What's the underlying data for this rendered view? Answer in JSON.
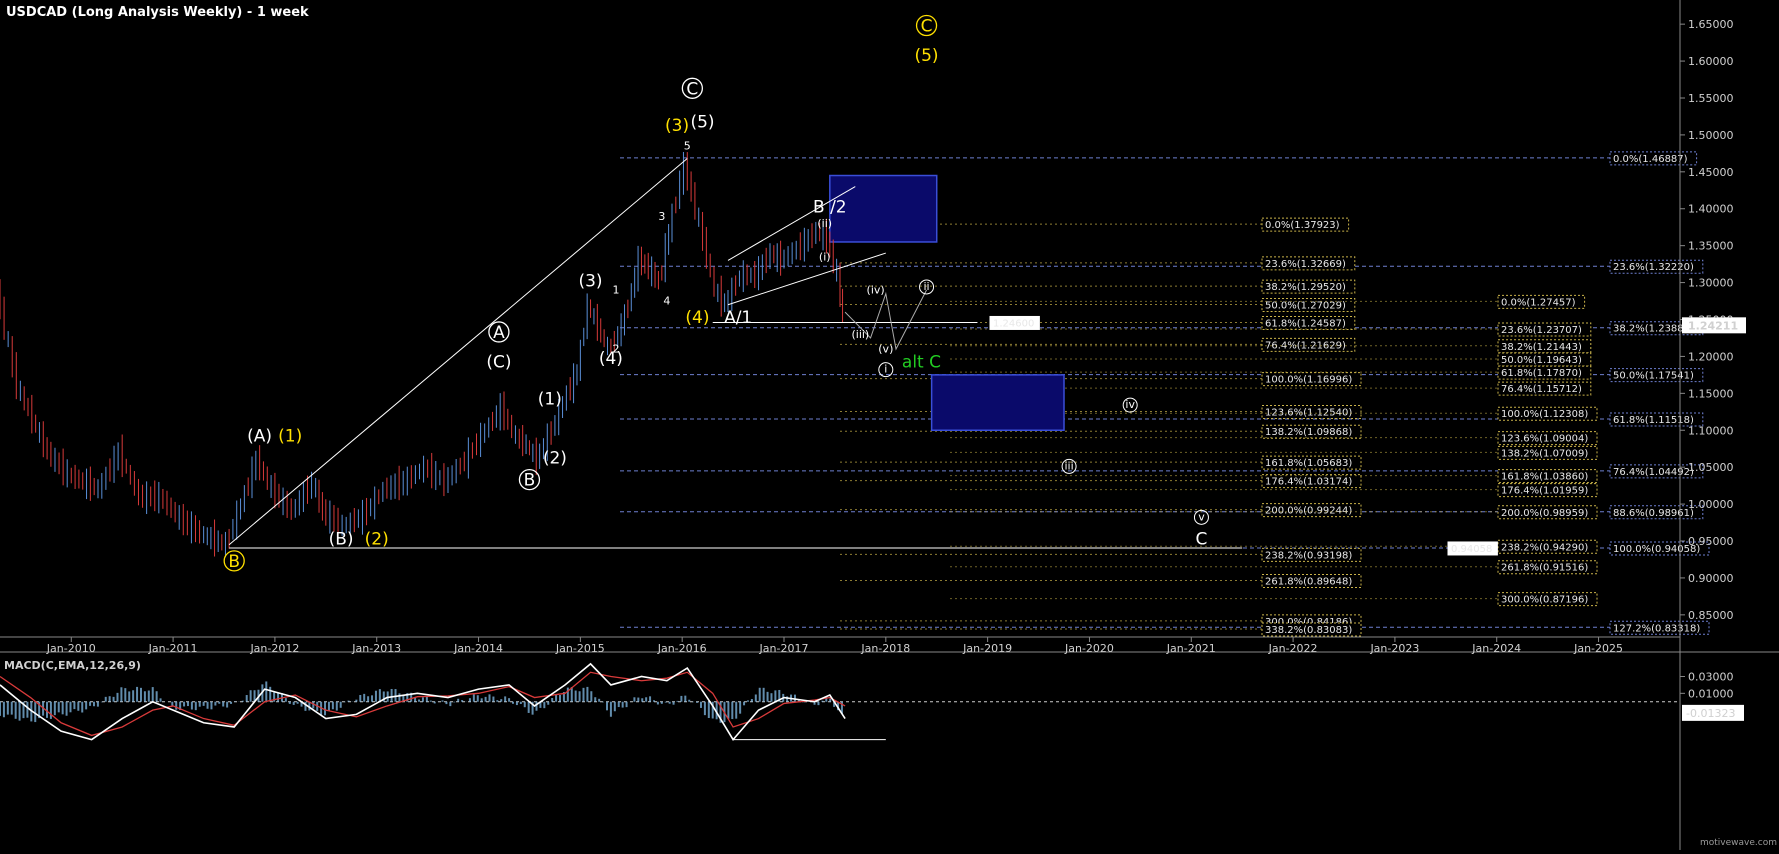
{
  "header": {
    "title": "USDCAD (Long  Analysis Weekly) - 1 week"
  },
  "footer": {
    "watermark": "motivewave.com"
  },
  "price_label": {
    "value": "1.24211",
    "price": 1.24211
  },
  "colors": {
    "background": "#000000",
    "bull_candle": "#5a8fd8",
    "bear_candle": "#d83a3a",
    "fib_grid": "#6e7fd0",
    "fib_box": "#c9b24a",
    "box_fill": "#0a0a6a",
    "box_stroke": "#3a4ed8",
    "wave_white": "#ffffff",
    "wave_yellow": "#ffe000",
    "wave_green": "#22cc22",
    "macd_line": "#ffffff",
    "signal_line": "#d83a3a",
    "hist": "#7ab0d8"
  },
  "chart_data": [
    {
      "type": "candlestick",
      "title": "USDCAD (Long  Analysis Weekly) - 1 week",
      "ylim": [
        0.82,
        1.68
      ],
      "xlim": [
        2009.3,
        2025.8
      ],
      "x_ticks": [
        "Jan-2010",
        "Jan-2011",
        "Jan-2012",
        "Jan-2013",
        "Jan-2014",
        "Jan-2015",
        "Jan-2016",
        "Jan-2017",
        "Jan-2018",
        "Jan-2019",
        "Jan-2020",
        "Jan-2021",
        "Jan-2022",
        "Jan-2023",
        "Jan-2024",
        "Jan-2025"
      ],
      "x_tick_positions": [
        2010,
        2011,
        2012,
        2013,
        2014,
        2015,
        2016,
        2017,
        2018,
        2019,
        2020,
        2021,
        2022,
        2023,
        2024,
        2025
      ],
      "y_ticks": [
        "1.65000",
        "1.60000",
        "1.55000",
        "1.50000",
        "1.45000",
        "1.40000",
        "1.35000",
        "1.30000",
        "1.25000",
        "1.20000",
        "1.15000",
        "1.10000",
        "1.05000",
        "1.00000",
        "0.95000",
        "0.90000",
        "0.85000"
      ],
      "y_tick_values": [
        1.65,
        1.6,
        1.55,
        1.5,
        1.45,
        1.4,
        1.35,
        1.3,
        1.25,
        1.2,
        1.15,
        1.1,
        1.05,
        1.0,
        0.95,
        0.9,
        0.85
      ],
      "price_path": [
        [
          2009.3,
          1.29
        ],
        [
          2009.5,
          1.16
        ],
        [
          2009.8,
          1.07
        ],
        [
          2010.0,
          1.04
        ],
        [
          2010.3,
          1.02
        ],
        [
          2010.5,
          1.07
        ],
        [
          2010.7,
          1.01
        ],
        [
          2010.9,
          1.01
        ],
        [
          2011.1,
          0.98
        ],
        [
          2011.3,
          0.96
        ],
        [
          2011.55,
          0.945
        ],
        [
          2011.7,
          1.0
        ],
        [
          2011.85,
          1.06
        ],
        [
          2012.0,
          1.02
        ],
        [
          2012.2,
          0.99
        ],
        [
          2012.4,
          1.03
        ],
        [
          2012.5,
          0.99
        ],
        [
          2012.7,
          0.97
        ],
        [
          2012.9,
          0.985
        ],
        [
          2013.1,
          1.02
        ],
        [
          2013.3,
          1.03
        ],
        [
          2013.5,
          1.05
        ],
        [
          2013.7,
          1.03
        ],
        [
          2013.9,
          1.06
        ],
        [
          2014.1,
          1.1
        ],
        [
          2014.25,
          1.13
        ],
        [
          2014.4,
          1.09
        ],
        [
          2014.5,
          1.08
        ],
        [
          2014.6,
          1.06
        ],
        [
          2014.75,
          1.1
        ],
        [
          2014.9,
          1.15
        ],
        [
          2015.0,
          1.18
        ],
        [
          2015.1,
          1.27
        ],
        [
          2015.2,
          1.24
        ],
        [
          2015.3,
          1.21
        ],
        [
          2015.4,
          1.23
        ],
        [
          2015.5,
          1.27
        ],
        [
          2015.6,
          1.33
        ],
        [
          2015.7,
          1.32
        ],
        [
          2015.8,
          1.3
        ],
        [
          2015.9,
          1.37
        ],
        [
          2016.05,
          1.46
        ],
        [
          2016.2,
          1.38
        ],
        [
          2016.35,
          1.29
        ],
        [
          2016.45,
          1.27
        ],
        [
          2016.6,
          1.31
        ],
        [
          2016.75,
          1.31
        ],
        [
          2016.9,
          1.34
        ],
        [
          2017.0,
          1.33
        ],
        [
          2017.2,
          1.35
        ],
        [
          2017.35,
          1.37
        ],
        [
          2017.45,
          1.36
        ],
        [
          2017.55,
          1.31
        ],
        [
          2017.6,
          1.255
        ]
      ],
      "fib_levels": [
        {
          "label": "0.0%(1.46887)",
          "value": 1.46887
        },
        {
          "label": "23.6%(1.32220)",
          "value": 1.3222
        },
        {
          "label": "38.2%(1.23889)",
          "value": 1.23889
        },
        {
          "label": "50.0%(1.17541)",
          "value": 1.17541
        },
        {
          "label": "61.8%(1.11518)",
          "value": 1.11518
        },
        {
          "label": "76.4%(1.04492)",
          "value": 1.04492
        },
        {
          "label": "88.6%(0.98961)",
          "value": 0.98961
        },
        {
          "label": "100.0%(0.94058)",
          "value": 0.94058
        },
        {
          "label": "127.2%(0.83318)",
          "value": 0.83318
        }
      ],
      "fib_mid": [
        {
          "label": "0.0%(1.37923)",
          "value": 1.37923
        },
        {
          "label": "23.6%(1.32669)",
          "value": 1.32669
        },
        {
          "label": "38.2%(1.29520)",
          "value": 1.2952
        },
        {
          "label": "50.0%(1.27029)",
          "value": 1.27029
        },
        {
          "label": "61.8%(1.24587)",
          "value": 1.24587
        },
        {
          "label": "76.4%(1.21629)",
          "value": 1.21629
        },
        {
          "label": "100.0%(1.16996)",
          "value": 1.16996
        },
        {
          "label": "123.6%(1.12540)",
          "value": 1.1254
        },
        {
          "label": "138.2%(1.09868)",
          "value": 1.09868
        },
        {
          "label": "161.8%(1.05683)",
          "value": 1.05683
        },
        {
          "label": "176.4%(1.03174)",
          "value": 1.03174
        },
        {
          "label": "200.0%(0.99244)",
          "value": 0.99244
        },
        {
          "label": "238.2%(0.93198)",
          "value": 0.93198
        },
        {
          "label": "261.8%(0.89648)",
          "value": 0.89648
        },
        {
          "label": "300.0%(0.84186)",
          "value": 0.84186
        },
        {
          "label": "338.2%(0.83083)",
          "value": 0.83083
        }
      ],
      "fib_right": [
        {
          "label": "0.0%(1.27457)",
          "value": 1.27457
        },
        {
          "label": "23.6%(1.23707)",
          "value": 1.23707
        },
        {
          "label": "38.2%(1.21443)",
          "value": 1.21443
        },
        {
          "label": "50.0%(1.19643)",
          "value": 1.19643
        },
        {
          "label": "61.8%(1.17870)",
          "value": 1.1787
        },
        {
          "label": "76.4%(1.15712)",
          "value": 1.15712
        },
        {
          "label": "100.0%(1.12308)",
          "value": 1.12308
        },
        {
          "label": "123.6%(1.09004)",
          "value": 1.09004
        },
        {
          "label": "138.2%(1.07009)",
          "value": 1.07009
        },
        {
          "label": "161.8%(1.03860)",
          "value": 1.0386
        },
        {
          "label": "176.4%(1.01959)",
          "value": 1.01959
        },
        {
          "label": "200.0%(0.98959)",
          "value": 0.98959
        },
        {
          "label": "238.2%(0.94290)",
          "value": 0.9429
        },
        {
          "label": "261.8%(0.91516)",
          "value": 0.91516
        },
        {
          "label": "300.0%(0.87196)",
          "value": 0.87196
        }
      ],
      "hlines": [
        {
          "label": "1.24600",
          "value": 1.246
        },
        {
          "label": "0.94058",
          "value": 0.94058
        }
      ],
      "wave_labels": [
        {
          "text": "(A)",
          "x": 2011.85,
          "y": 1.085,
          "color": "white"
        },
        {
          "text": "(1)",
          "x": 2012.15,
          "y": 1.085,
          "color": "yellow"
        },
        {
          "text": "(B)",
          "x": 2012.65,
          "y": 0.945,
          "color": "white"
        },
        {
          "text": "(2)",
          "x": 2013.0,
          "y": 0.945,
          "color": "yellow"
        },
        {
          "text": "B",
          "x": 2011.6,
          "y": 0.915,
          "color": "yellow",
          "circled": true
        },
        {
          "text": "A",
          "x": 2014.2,
          "y": 1.225,
          "color": "white",
          "circled": true
        },
        {
          "text": "(C)",
          "x": 2014.2,
          "y": 1.185,
          "color": "white"
        },
        {
          "text": "(1)",
          "x": 2014.7,
          "y": 1.135,
          "color": "white"
        },
        {
          "text": "(2)",
          "x": 2014.75,
          "y": 1.055,
          "color": "white"
        },
        {
          "text": "B",
          "x": 2014.5,
          "y": 1.025,
          "color": "white",
          "circled": true
        },
        {
          "text": "(3)",
          "x": 2015.1,
          "y": 1.295,
          "color": "white"
        },
        {
          "text": "(4)",
          "x": 2015.3,
          "y": 1.19,
          "color": "white"
        },
        {
          "text": "(3)",
          "x": 2015.95,
          "y": 1.505,
          "color": "yellow"
        },
        {
          "text": "(5)",
          "x": 2016.2,
          "y": 1.51,
          "color": "white"
        },
        {
          "text": "C",
          "x": 2016.1,
          "y": 1.555,
          "color": "white",
          "circled": true
        },
        {
          "text": "(4)",
          "x": 2016.15,
          "y": 1.245,
          "color": "yellow"
        },
        {
          "text": "A/1",
          "x": 2016.55,
          "y": 1.245,
          "color": "white"
        },
        {
          "text": "B /2",
          "x": 2017.45,
          "y": 1.395,
          "color": "white"
        },
        {
          "text": "alt C",
          "x": 2018.35,
          "y": 1.185,
          "color": "green"
        },
        {
          "text": "C",
          "x": 2018.4,
          "y": 1.64,
          "color": "yellow",
          "circled": true
        },
        {
          "text": "(5)",
          "x": 2018.4,
          "y": 1.6,
          "color": "yellow"
        },
        {
          "text": "C",
          "x": 2021.1,
          "y": 0.945,
          "color": "white"
        }
      ],
      "minor_labels": [
        {
          "text": "5",
          "x": 2016.05,
          "y": 1.48
        },
        {
          "text": "3",
          "x": 2015.8,
          "y": 1.385
        },
        {
          "text": "4",
          "x": 2015.85,
          "y": 1.27
        },
        {
          "text": "1",
          "x": 2015.35,
          "y": 1.285
        },
        {
          "text": "2",
          "x": 2015.35,
          "y": 1.205
        },
        {
          "text": "(ii)",
          "x": 2017.4,
          "y": 1.375
        },
        {
          "text": "(i)",
          "x": 2017.4,
          "y": 1.33
        },
        {
          "text": "(iv)",
          "x": 2017.9,
          "y": 1.285
        },
        {
          "text": "(iii)",
          "x": 2017.75,
          "y": 1.225
        },
        {
          "text": "(v)",
          "x": 2018.0,
          "y": 1.205
        }
      ],
      "circled_roman": [
        {
          "text": "ii",
          "x": 2018.4,
          "y": 1.29
        },
        {
          "text": "i",
          "x": 2018.0,
          "y": 1.178
        },
        {
          "text": "iv",
          "x": 2020.4,
          "y": 1.13
        },
        {
          "text": "iii",
          "x": 2019.8,
          "y": 1.047
        },
        {
          "text": "v",
          "x": 2021.1,
          "y": 0.978
        }
      ]
    },
    {
      "type": "line",
      "title": "MACD(C,EMA,12,26,9)",
      "ylim": [
        -0.055,
        0.052
      ],
      "y_ticks": [
        "0.03000",
        "0.01000"
      ],
      "y_tick_values": [
        0.03,
        0.01
      ],
      "last_value_label": "-0.01323",
      "last_value": -0.01323,
      "series": [
        {
          "values": [
            [
              2009.3,
              0.02
            ],
            [
              2009.6,
              -0.01
            ],
            [
              2009.9,
              -0.035
            ],
            [
              2010.2,
              -0.045
            ],
            [
              2010.5,
              -0.02
            ],
            [
              2010.8,
              0.0
            ],
            [
              2011.0,
              -0.01
            ],
            [
              2011.3,
              -0.025
            ],
            [
              2011.6,
              -0.03
            ],
            [
              2011.9,
              0.015
            ],
            [
              2012.2,
              0.005
            ],
            [
              2012.5,
              -0.02
            ],
            [
              2012.8,
              -0.015
            ],
            [
              2013.1,
              0.005
            ],
            [
              2013.4,
              0.01
            ],
            [
              2013.7,
              0.005
            ],
            [
              2014.0,
              0.015
            ],
            [
              2014.3,
              0.02
            ],
            [
              2014.55,
              -0.005
            ],
            [
              2014.85,
              0.02
            ],
            [
              2015.1,
              0.045
            ],
            [
              2015.3,
              0.02
            ],
            [
              2015.6,
              0.03
            ],
            [
              2015.85,
              0.025
            ],
            [
              2016.05,
              0.04
            ],
            [
              2016.3,
              -0.005
            ],
            [
              2016.5,
              -0.045
            ],
            [
              2016.75,
              -0.01
            ],
            [
              2017.0,
              0.005
            ],
            [
              2017.3,
              0.0
            ],
            [
              2017.45,
              0.008
            ],
            [
              2017.6,
              -0.02
            ]
          ]
        },
        {
          "values": [
            [
              2009.3,
              0.03
            ],
            [
              2009.6,
              0.005
            ],
            [
              2009.9,
              -0.025
            ],
            [
              2010.2,
              -0.04
            ],
            [
              2010.5,
              -0.03
            ],
            [
              2010.8,
              -0.01
            ],
            [
              2011.0,
              -0.005
            ],
            [
              2011.3,
              -0.02
            ],
            [
              2011.6,
              -0.028
            ],
            [
              2011.9,
              0.0
            ],
            [
              2012.2,
              0.008
            ],
            [
              2012.5,
              -0.01
            ],
            [
              2012.8,
              -0.018
            ],
            [
              2013.1,
              -0.005
            ],
            [
              2013.4,
              0.006
            ],
            [
              2013.7,
              0.007
            ],
            [
              2014.0,
              0.01
            ],
            [
              2014.3,
              0.018
            ],
            [
              2014.55,
              0.005
            ],
            [
              2014.85,
              0.01
            ],
            [
              2015.1,
              0.035
            ],
            [
              2015.3,
              0.03
            ],
            [
              2015.6,
              0.025
            ],
            [
              2015.85,
              0.028
            ],
            [
              2016.05,
              0.035
            ],
            [
              2016.3,
              0.01
            ],
            [
              2016.5,
              -0.03
            ],
            [
              2016.75,
              -0.02
            ],
            [
              2017.0,
              -0.002
            ],
            [
              2017.3,
              0.002
            ],
            [
              2017.45,
              0.005
            ],
            [
              2017.6,
              -0.005
            ]
          ]
        }
      ]
    }
  ]
}
